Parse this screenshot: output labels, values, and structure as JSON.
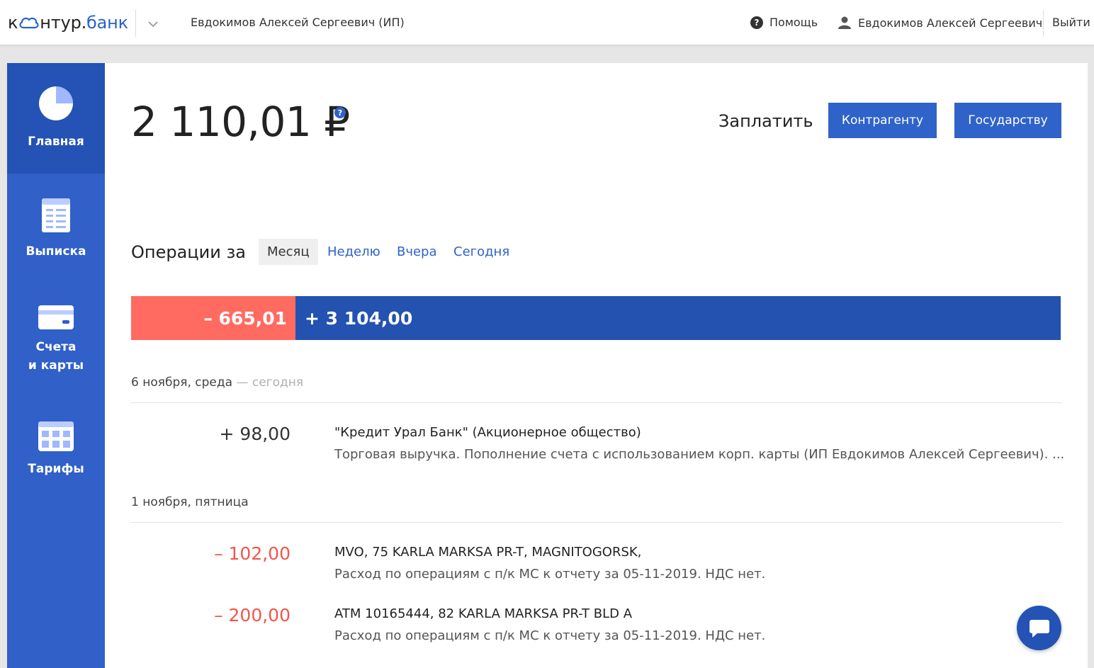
{
  "header": {
    "logo_prefix": "к",
    "logo_middle": "нтур.",
    "logo_suffix": "банк",
    "org_name": "Евдокимов Алексей Сергеевич (ИП)",
    "help_label": "Помощь",
    "user_name": "Евдокимов Алексей Сергеевич",
    "logout_label": "Выйти"
  },
  "sidebar": {
    "items": [
      {
        "label": "Главная",
        "icon": "pie-chart-icon",
        "active": true
      },
      {
        "label": "Выписка",
        "icon": "statement-icon",
        "active": false
      },
      {
        "label_line1": "Счета",
        "label_line2": "и карты",
        "icon": "card-icon",
        "active": false
      },
      {
        "label": "Тарифы",
        "icon": "calendar-icon",
        "active": false
      }
    ]
  },
  "balance": {
    "amount": "2 110,01 ₽",
    "help_glyph": "?"
  },
  "pay": {
    "label": "Заплатить",
    "counterparty_button": "Контрагенту",
    "state_button": "Государству"
  },
  "operations": {
    "title": "Операции за",
    "periods": [
      "Месяц",
      "Неделю",
      "Вчера",
      "Сегодня"
    ],
    "active_period": "Месяц",
    "outgoing": "– 665,01",
    "incoming": "+ 3 104,00"
  },
  "days": [
    {
      "date": "6 ноября, среда",
      "suffix": " — сегодня",
      "transactions": [
        {
          "amount": "+ 98,00",
          "title": "\"Кредит Урал Банк\" (Акционерное общество)",
          "description": "Торговая выручка. Пополнение счета с использованием корп. карты (ИП Евдокимов Алексей Сергеевич). ..."
        }
      ]
    },
    {
      "date": "1 ноября, пятница",
      "suffix": "",
      "transactions": [
        {
          "amount": "– 102,00",
          "title": "MVO, 75 KARLA MARKSA PR-T, MAGNITOGORSK,",
          "description": "Расход по операциям с п/к МС к отчету за 05-11-2019. НДС нет."
        },
        {
          "amount": "– 200,00",
          "title": "ATM 10165444, 82 KARLA MARKSA PR-T BLD A",
          "description": "Расход по операциям с п/к МС к отчету за 05-11-2019. НДС нет."
        }
      ]
    }
  ],
  "colors": {
    "accent": "#2f63c9",
    "sidebar": "#3060c8",
    "sidebar_active": "#2452b5",
    "expense": "#ff6b61",
    "income_bar": "#2452b0"
  }
}
